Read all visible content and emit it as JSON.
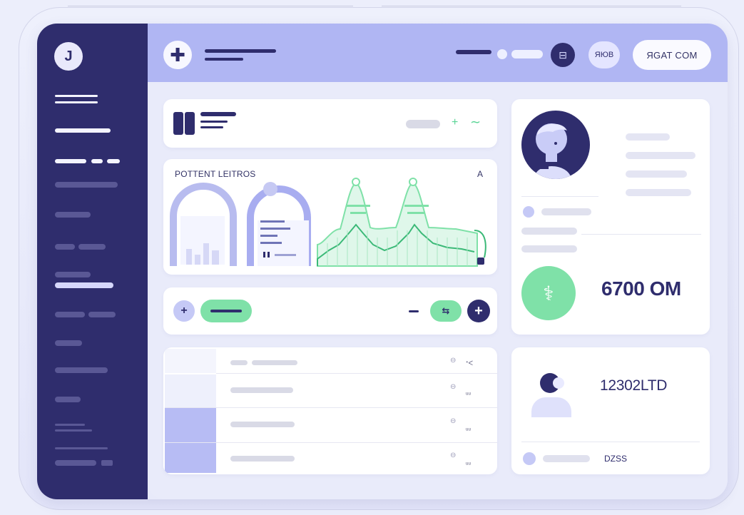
{
  "header": {
    "action_label": "ЯGAT COM",
    "chip_label": "ЯЮВ",
    "menu_icon": "grid-icon"
  },
  "sidebar": {
    "logo_letter": "J"
  },
  "chart_card": {
    "title": "POTTENT LEITROS",
    "flag": "A"
  },
  "profile": {
    "stat_value": "6700 OM"
  },
  "second_stat": {
    "value": "12302LTD",
    "code": "DZSS"
  },
  "table": {
    "rows": [
      {
        "icon": "⊖",
        "mini": "ᐩᐸ"
      },
      {
        "icon": "⊖",
        "mini": "ᵤᵤ"
      },
      {
        "icon": "⊖",
        "mini": "ᵤᵤ"
      },
      {
        "icon": "⊖",
        "mini": "ᵤᵤ"
      }
    ]
  },
  "colors": {
    "navy": "#2f2d6d",
    "periwinkle": "#b0b6f3",
    "mint": "#7fe1a8",
    "background": "#e9ebfa"
  }
}
